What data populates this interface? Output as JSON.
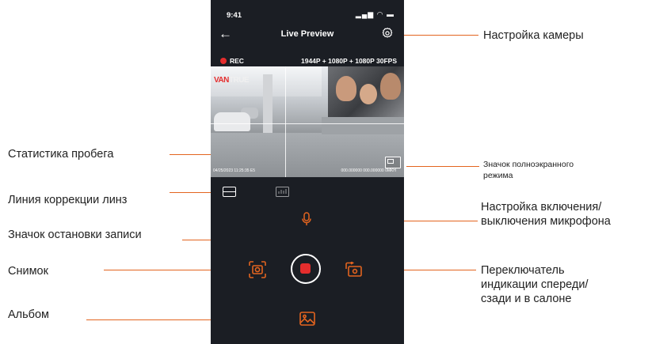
{
  "status_bar": {
    "time": "9:41",
    "icons": "▂▄▆ ◠ ▬"
  },
  "header": {
    "back": "←",
    "title": "Live Preview",
    "settings_icon": "gear-icon"
  },
  "recording": {
    "indicator": "REC",
    "resolution": "1944P + 1080P + 1080P 30FPS",
    "indicator_color": "#e52d2d"
  },
  "video": {
    "logo_part1": "VAN",
    "logo_part2": "TRUE",
    "timestamp": "04/25/2023  11:25:35  E5",
    "gps": "000.000000   000.000000   0MKH"
  },
  "callouts": {
    "camera_settings": "Настройка камеры",
    "mileage_stats": "Статистика пробега",
    "fullscreen_line1": "Значок полноэкранного",
    "fullscreen_line2": "режима",
    "lens_correction": "Линия коррекции линз",
    "mic_line1": "Настройка включения/",
    "mic_line2": "выключения микрофона",
    "stop_recording": "Значок остановки записи",
    "snapshot": "Снимок",
    "switch_line1": "Переключатель",
    "switch_line2": "индикации спереди/",
    "switch_line3": "сзади и в салоне",
    "album": "Альбом"
  },
  "colors": {
    "accent": "#e3641f",
    "phone_bg": "#1b1e24",
    "record": "#e52d2d"
  }
}
